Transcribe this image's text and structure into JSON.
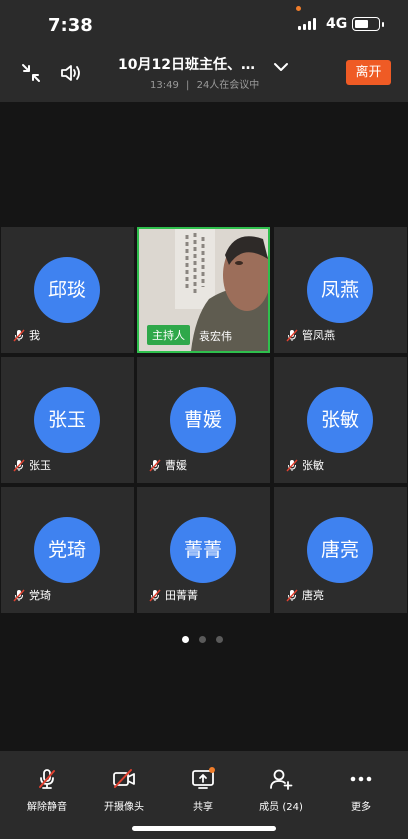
{
  "status_bar": {
    "time": "7:38",
    "network": "4G"
  },
  "header": {
    "title": "10月12日班主任、…",
    "time": "13:49",
    "separator": "|",
    "participants_text": "24人在会议中",
    "leave_label": "离开"
  },
  "grid": {
    "tiles": [
      {
        "avatar": "邱琰",
        "name": "我"
      },
      {
        "video": true,
        "host_badge": "主持人",
        "name": "袁宏伟"
      },
      {
        "avatar": "凤燕",
        "name": "管凤燕"
      },
      {
        "avatar": "张玉",
        "name": "张玉"
      },
      {
        "avatar": "曹媛",
        "name": "曹媛"
      },
      {
        "avatar": "张敏",
        "name": "张敏"
      },
      {
        "avatar": "党琦",
        "name": "党琦"
      },
      {
        "avatar": "菁菁",
        "name": "田菁菁"
      },
      {
        "avatar": "唐亮",
        "name": "唐亮"
      }
    ]
  },
  "pager": {
    "pages": 3,
    "current": 1
  },
  "toolbar": {
    "unmute_label": "解除静音",
    "camera_label": "开摄像头",
    "share_label": "共享",
    "members_label": "成员 (24)",
    "more_label": "更多"
  },
  "colors": {
    "accent": "#3f82f0",
    "leave": "#ef5b25",
    "host_badge": "#2fa84a",
    "notify": "#f07d2a"
  }
}
